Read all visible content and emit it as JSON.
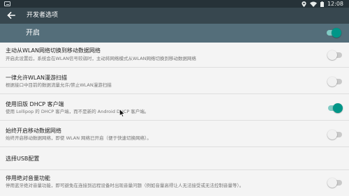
{
  "status_bar": {
    "time": "12:08",
    "icons": [
      "image-notification-icon",
      "location-icon",
      "wifi-icon",
      "battery-icon"
    ]
  },
  "toolbar": {
    "title": "开发者选项",
    "back_icon": "arrow-back-icon"
  },
  "master_switch": {
    "label": "开启",
    "on": true
  },
  "settings": [
    {
      "title": "主动从WLAN网络切换到移动数据网络",
      "summary": "开启此设置后，系统会在WLAN信号较弱时，主动将网络模式从WLAN网络切换到移动数据网络",
      "switch_on": false
    },
    {
      "title": "一律允许WLAN漫游扫描",
      "summary": "根据接口中目前的数据流量允许/禁止WLAN漫游扫描",
      "switch_on": false
    },
    {
      "title": "使用旧版 DHCP 客户端",
      "summary": "使用 Lollipop 的 DHCP 客户端，而不是新的 Android DHCP 客户端。",
      "switch_on": true
    },
    {
      "title": "始终开启移动数据网络",
      "summary": "始终开启移动数据网络，即使 WLAN 网络已开启（便于快速切换网络）。",
      "switch_on": false
    },
    {
      "title": "选择USB配置",
      "summary": ""
    },
    {
      "title": "停用绝对音量功能",
      "summary": "停用蓝牙绝对音量功能，即可避免在连接到远程设备时出现音量问题（例如音量高得让人无法接受或无法控制音量等）。",
      "switch_on": false
    }
  ],
  "colors": {
    "status_bar": "#263238",
    "toolbar": "#37474f",
    "master_bar": "#546e7a",
    "accent": "#009688",
    "background": "#f4f4f4"
  }
}
